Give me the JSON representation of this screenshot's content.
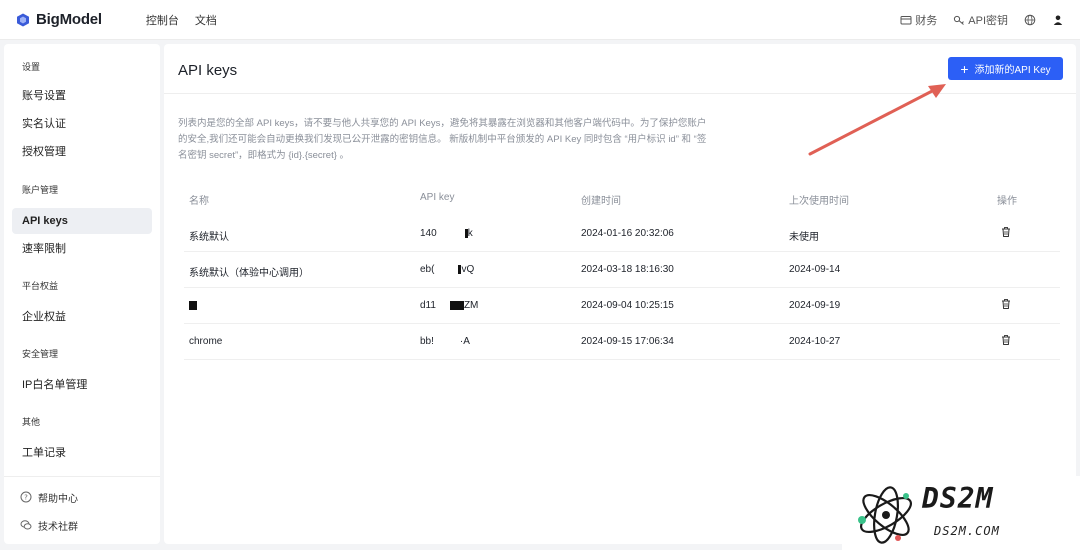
{
  "header": {
    "brand": "BigModel",
    "nav": [
      "控制台",
      "文档"
    ],
    "finance": "财务",
    "api_keys": "API密钥"
  },
  "sidebar": {
    "groups": [
      {
        "title": "设置",
        "items": [
          "账号设置",
          "实名认证",
          "授权管理"
        ]
      },
      {
        "title": "账户管理",
        "items": [
          "API keys",
          "速率限制"
        ]
      },
      {
        "title": "平台权益",
        "items": [
          "企业权益"
        ]
      },
      {
        "title": "安全管理",
        "items": [
          "IP白名单管理"
        ]
      },
      {
        "title": "其他",
        "items": [
          "工单记录"
        ]
      }
    ],
    "active": "API keys",
    "help": "帮助中心",
    "community": "技术社群"
  },
  "main": {
    "title": "API keys",
    "add_button": "添加新的API Key",
    "notice": "列表内是您的全部 API keys，请不要与他人共享您的 API Keys，避免将其暴露在浏览器和其他客户端代码中。为了保护您账户的安全,我们还可能会自动更换我们发现已公开泄露的密钥信息。 新版机制中平台颁发的 API Key 同时包含 “用户标识 id” 和 “签名密钥 secret”，即格式为 {id}.{secret} 。",
    "table": {
      "columns": [
        "名称",
        "API key",
        "创建时间",
        "上次使用时间",
        "操作"
      ],
      "rows": [
        {
          "name": "系统默认",
          "key_start": "140",
          "key_end": "k",
          "created": "2024-01-16 20:32:06",
          "last_used": "未使用",
          "deletable": true
        },
        {
          "name": "系统默认（体验中心调用）",
          "key_start": "eb(",
          "key_end": "vQ",
          "created": "2024-03-18 18:16:30",
          "last_used": "2024-09-14",
          "deletable": false
        },
        {
          "name": "",
          "key_start": "d11",
          "key_end": "ZM",
          "created": "2024-09-04 10:25:15",
          "last_used": "2024-09-19",
          "deletable": true
        },
        {
          "name": "chrome",
          "key_start": "bb!",
          "key_end": "·A",
          "created": "2024-09-15 17:06:34",
          "last_used": "2024-10-27",
          "deletable": true
        }
      ]
    }
  },
  "watermark": {
    "text": "DS2M",
    "sub": "DS2M.COM"
  },
  "colors": {
    "primary": "#2c5ff6",
    "arrow": "#e06055"
  }
}
